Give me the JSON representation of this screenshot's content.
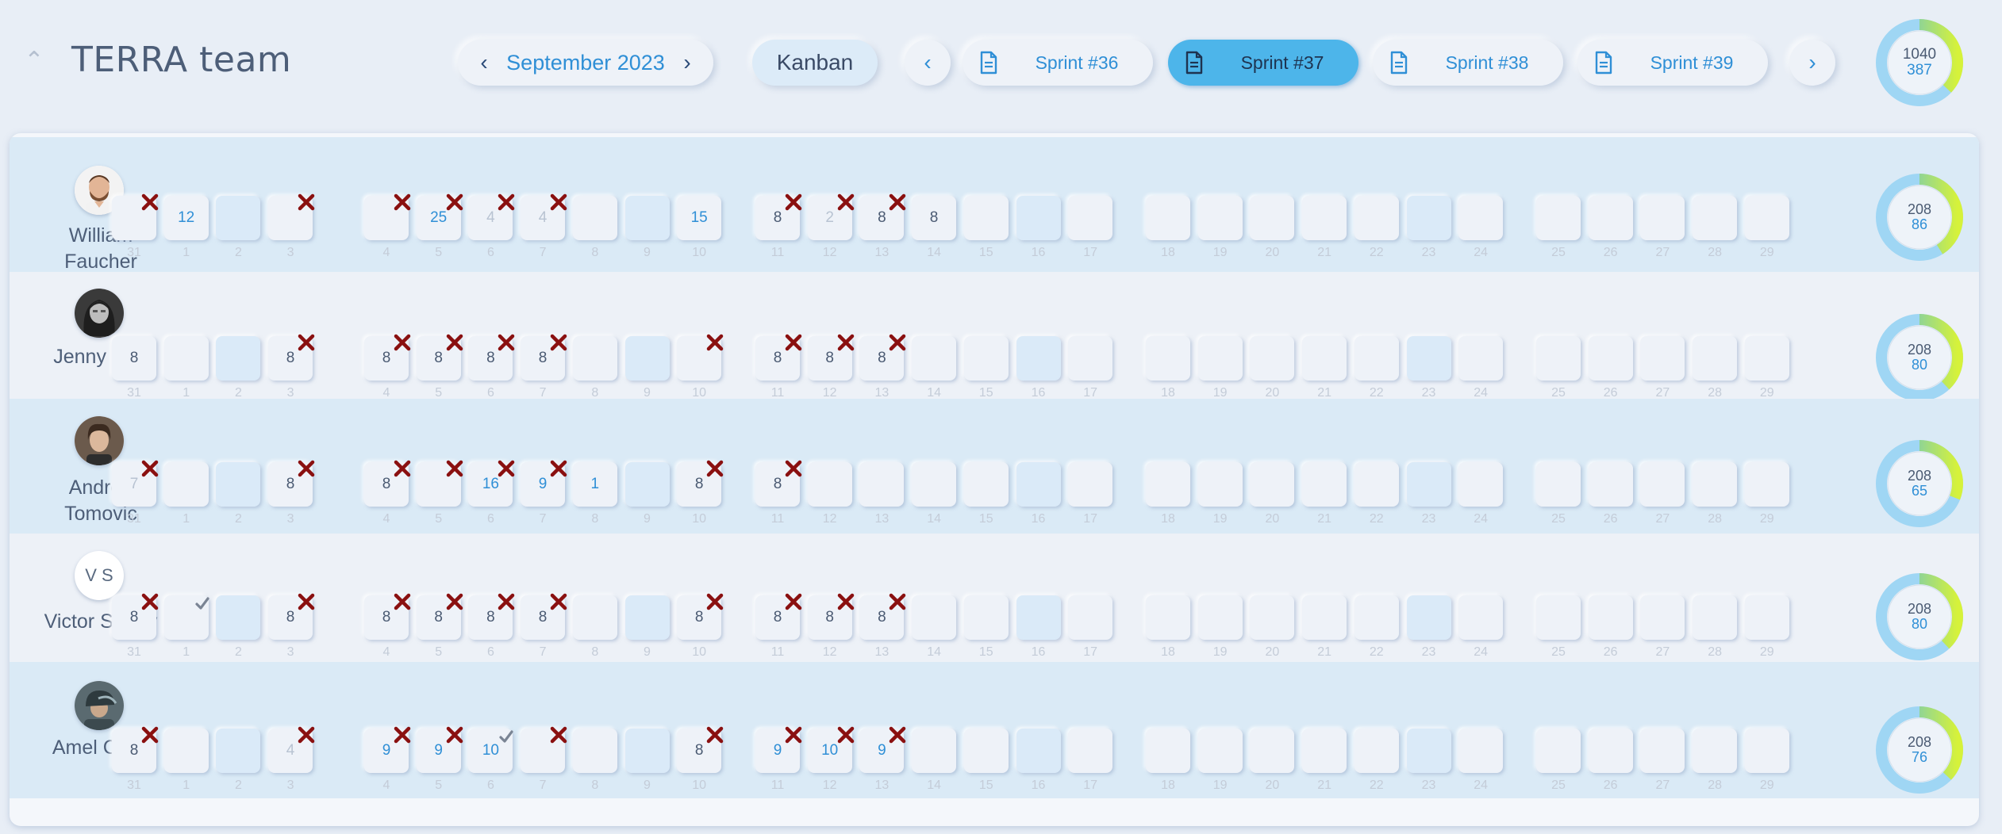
{
  "header": {
    "team_name": "TERRA team",
    "month": "September 2023",
    "kanban_label": "Kanban",
    "sprints": [
      {
        "label": "Sprint #36",
        "active": false
      },
      {
        "label": "Sprint #37",
        "active": true
      },
      {
        "label": "Sprint #38",
        "active": false
      },
      {
        "label": "Sprint #39",
        "active": false
      }
    ],
    "total": {
      "top": "1040",
      "bottom": "387",
      "fraction": 0.37
    }
  },
  "days": [
    "31",
    "1",
    "2",
    "3",
    "4",
    "5",
    "6",
    "7",
    "8",
    "9",
    "10",
    "11",
    "12",
    "13",
    "14",
    "15",
    "16",
    "17",
    "18",
    "19",
    "20",
    "21",
    "22",
    "23",
    "24",
    "25",
    "26",
    "27",
    "28",
    "29"
  ],
  "weekend_indices": [
    2,
    9,
    16,
    23
  ],
  "members": [
    {
      "name": "William Faucher",
      "avatar": "photo-man-beard",
      "ring": {
        "top": "208",
        "bottom": "86",
        "fraction": 0.41
      },
      "cells": [
        {
          "v": "",
          "m": "x"
        },
        {
          "v": "12",
          "c": "blue"
        },
        {
          "v": ""
        },
        {
          "v": "",
          "m": "x"
        },
        {
          "v": "",
          "m": "x"
        },
        {
          "v": "25",
          "c": "blue",
          "m": "x"
        },
        {
          "v": "4",
          "c": "faint",
          "m": "x"
        },
        {
          "v": "4",
          "c": "faint",
          "m": "x"
        },
        {
          "v": ""
        },
        {
          "v": ""
        },
        {
          "v": "15",
          "c": "blue"
        },
        {
          "v": "8",
          "c": "grey",
          "m": "x"
        },
        {
          "v": "2",
          "c": "faint",
          "m": "x"
        },
        {
          "v": "8",
          "c": "grey",
          "m": "x"
        },
        {
          "v": "8",
          "c": "grey"
        },
        {
          "v": ""
        },
        {
          "v": ""
        },
        {
          "v": ""
        },
        {
          "v": ""
        },
        {
          "v": ""
        },
        {
          "v": ""
        },
        {
          "v": ""
        },
        {
          "v": ""
        },
        {
          "v": ""
        },
        {
          "v": ""
        },
        {
          "v": ""
        },
        {
          "v": ""
        },
        {
          "v": ""
        },
        {
          "v": ""
        },
        {
          "v": ""
        }
      ]
    },
    {
      "name": "Jenny Rod",
      "avatar": "photo-woman-bw",
      "ring": {
        "top": "208",
        "bottom": "80",
        "fraction": 0.38
      },
      "cells": [
        {
          "v": "8",
          "c": "grey"
        },
        {
          "v": ""
        },
        {
          "v": ""
        },
        {
          "v": "8",
          "c": "grey",
          "m": "x"
        },
        {
          "v": "8",
          "c": "grey",
          "m": "x"
        },
        {
          "v": "8",
          "c": "grey",
          "m": "x"
        },
        {
          "v": "8",
          "c": "grey",
          "m": "x"
        },
        {
          "v": "8",
          "c": "grey",
          "m": "x"
        },
        {
          "v": ""
        },
        {
          "v": ""
        },
        {
          "v": "",
          "m": "x"
        },
        {
          "v": "8",
          "c": "grey",
          "m": "x"
        },
        {
          "v": "8",
          "c": "grey",
          "m": "x"
        },
        {
          "v": "8",
          "c": "grey",
          "m": "x"
        },
        {
          "v": ""
        },
        {
          "v": ""
        },
        {
          "v": ""
        },
        {
          "v": ""
        },
        {
          "v": ""
        },
        {
          "v": ""
        },
        {
          "v": ""
        },
        {
          "v": ""
        },
        {
          "v": ""
        },
        {
          "v": ""
        },
        {
          "v": ""
        },
        {
          "v": ""
        },
        {
          "v": ""
        },
        {
          "v": ""
        },
        {
          "v": ""
        },
        {
          "v": ""
        }
      ]
    },
    {
      "name": "Andrea Tomovic",
      "avatar": "photo-young-man",
      "ring": {
        "top": "208",
        "bottom": "65",
        "fraction": 0.31
      },
      "cells": [
        {
          "v": "7",
          "c": "faint",
          "m": "x"
        },
        {
          "v": ""
        },
        {
          "v": ""
        },
        {
          "v": "8",
          "c": "grey",
          "m": "x"
        },
        {
          "v": "8",
          "c": "grey",
          "m": "x"
        },
        {
          "v": "",
          "m": "x"
        },
        {
          "v": "16",
          "c": "blue",
          "m": "x"
        },
        {
          "v": "9",
          "c": "blue",
          "m": "x"
        },
        {
          "v": "1",
          "c": "blue"
        },
        {
          "v": ""
        },
        {
          "v": "8",
          "c": "grey",
          "m": "x"
        },
        {
          "v": "8",
          "c": "grey",
          "m": "x"
        },
        {
          "v": ""
        },
        {
          "v": ""
        },
        {
          "v": ""
        },
        {
          "v": ""
        },
        {
          "v": ""
        },
        {
          "v": ""
        },
        {
          "v": ""
        },
        {
          "v": ""
        },
        {
          "v": ""
        },
        {
          "v": ""
        },
        {
          "v": ""
        },
        {
          "v": ""
        },
        {
          "v": ""
        },
        {
          "v": ""
        },
        {
          "v": ""
        },
        {
          "v": ""
        },
        {
          "v": ""
        },
        {
          "v": ""
        }
      ]
    },
    {
      "name": "Victor Starny",
      "avatar_initials": "V S",
      "ring": {
        "top": "208",
        "bottom": "80",
        "fraction": 0.38
      },
      "cells": [
        {
          "v": "8",
          "c": "grey",
          "m": "x"
        },
        {
          "v": "",
          "m": "check"
        },
        {
          "v": ""
        },
        {
          "v": "8",
          "c": "grey",
          "m": "x"
        },
        {
          "v": "8",
          "c": "grey",
          "m": "x"
        },
        {
          "v": "8",
          "c": "grey",
          "m": "x"
        },
        {
          "v": "8",
          "c": "grey",
          "m": "x"
        },
        {
          "v": "8",
          "c": "grey",
          "m": "x"
        },
        {
          "v": ""
        },
        {
          "v": ""
        },
        {
          "v": "8",
          "c": "grey",
          "m": "x"
        },
        {
          "v": "8",
          "c": "grey",
          "m": "x"
        },
        {
          "v": "8",
          "c": "grey",
          "m": "x"
        },
        {
          "v": "8",
          "c": "grey",
          "m": "x"
        },
        {
          "v": ""
        },
        {
          "v": ""
        },
        {
          "v": ""
        },
        {
          "v": ""
        },
        {
          "v": ""
        },
        {
          "v": ""
        },
        {
          "v": ""
        },
        {
          "v": ""
        },
        {
          "v": ""
        },
        {
          "v": ""
        },
        {
          "v": ""
        },
        {
          "v": ""
        },
        {
          "v": ""
        },
        {
          "v": ""
        },
        {
          "v": ""
        },
        {
          "v": ""
        }
      ]
    },
    {
      "name": "Amel Curic",
      "avatar": "photo-man-helmet",
      "ring": {
        "top": "208",
        "bottom": "76",
        "fraction": 0.37
      },
      "cells": [
        {
          "v": "8",
          "c": "grey",
          "m": "x"
        },
        {
          "v": ""
        },
        {
          "v": ""
        },
        {
          "v": "4",
          "c": "faint",
          "m": "x"
        },
        {
          "v": "9",
          "c": "blue",
          "m": "x"
        },
        {
          "v": "9",
          "c": "blue",
          "m": "x"
        },
        {
          "v": "10",
          "c": "blue",
          "m": "check"
        },
        {
          "v": "",
          "m": "x"
        },
        {
          "v": ""
        },
        {
          "v": ""
        },
        {
          "v": "8",
          "c": "grey",
          "m": "x"
        },
        {
          "v": "9",
          "c": "blue",
          "m": "x"
        },
        {
          "v": "10",
          "c": "blue",
          "m": "x"
        },
        {
          "v": "9",
          "c": "blue",
          "m": "x"
        },
        {
          "v": ""
        },
        {
          "v": ""
        },
        {
          "v": ""
        },
        {
          "v": ""
        },
        {
          "v": ""
        },
        {
          "v": ""
        },
        {
          "v": ""
        },
        {
          "v": ""
        },
        {
          "v": ""
        },
        {
          "v": ""
        },
        {
          "v": ""
        },
        {
          "v": ""
        },
        {
          "v": ""
        },
        {
          "v": ""
        },
        {
          "v": ""
        },
        {
          "v": ""
        }
      ]
    }
  ]
}
